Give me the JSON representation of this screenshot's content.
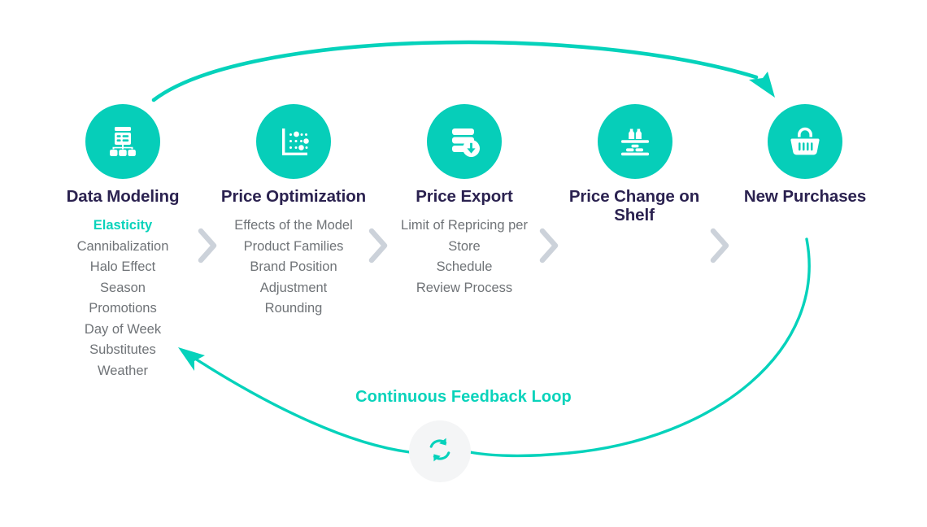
{
  "diagram": {
    "accent_color": "#06ceb9",
    "accent_text_color": "#0ad3bb",
    "title_color": "#2b2250",
    "body_text_color": "#6f7377",
    "chevron_color": "#ccd2da",
    "badge_bg_color": "#f4f5f6",
    "steps": [
      {
        "id": "data-modeling",
        "title": "Data Modeling",
        "icon": "data-modeling-icon",
        "items": [
          {
            "label": "Elasticity",
            "highlight": true
          },
          {
            "label": "Cannibalization",
            "highlight": false
          },
          {
            "label": "Halo Effect",
            "highlight": false
          },
          {
            "label": "Season",
            "highlight": false
          },
          {
            "label": "Promotions",
            "highlight": false
          },
          {
            "label": "Day of Week",
            "highlight": false
          },
          {
            "label": "Substitutes",
            "highlight": false
          },
          {
            "label": "Weather",
            "highlight": false
          }
        ]
      },
      {
        "id": "price-optimization",
        "title": "Price Optimization",
        "icon": "scatter-plot-icon",
        "items": [
          {
            "label": "Effects of the Model",
            "highlight": false
          },
          {
            "label": "Product Families",
            "highlight": false
          },
          {
            "label": "Brand Position Adjustment",
            "highlight": false
          },
          {
            "label": "Rounding",
            "highlight": false
          }
        ]
      },
      {
        "id": "price-export",
        "title": "Price Export",
        "icon": "database-download-icon",
        "items": [
          {
            "label": "Limit of Repricing per Store",
            "highlight": false
          },
          {
            "label": "Schedule",
            "highlight": false
          },
          {
            "label": "Review Process",
            "highlight": false
          }
        ]
      },
      {
        "id": "price-change-on-shelf",
        "title": "Price Change on Shelf",
        "icon": "store-shelf-icon",
        "items": []
      },
      {
        "id": "new-purchases",
        "title": "New Purchases",
        "icon": "shopping-basket-icon",
        "items": []
      }
    ],
    "feedback_loop": {
      "label": "Continuous Feedback Loop",
      "icon": "refresh-sync-icon"
    },
    "separator_icon": "chevron-right-icon",
    "flow_arrows": [
      {
        "id": "top-arrow",
        "from": "data-modeling",
        "to": "new-purchases"
      },
      {
        "id": "feedback-arrow",
        "from": "new-purchases",
        "to": "data-modeling"
      }
    ]
  }
}
